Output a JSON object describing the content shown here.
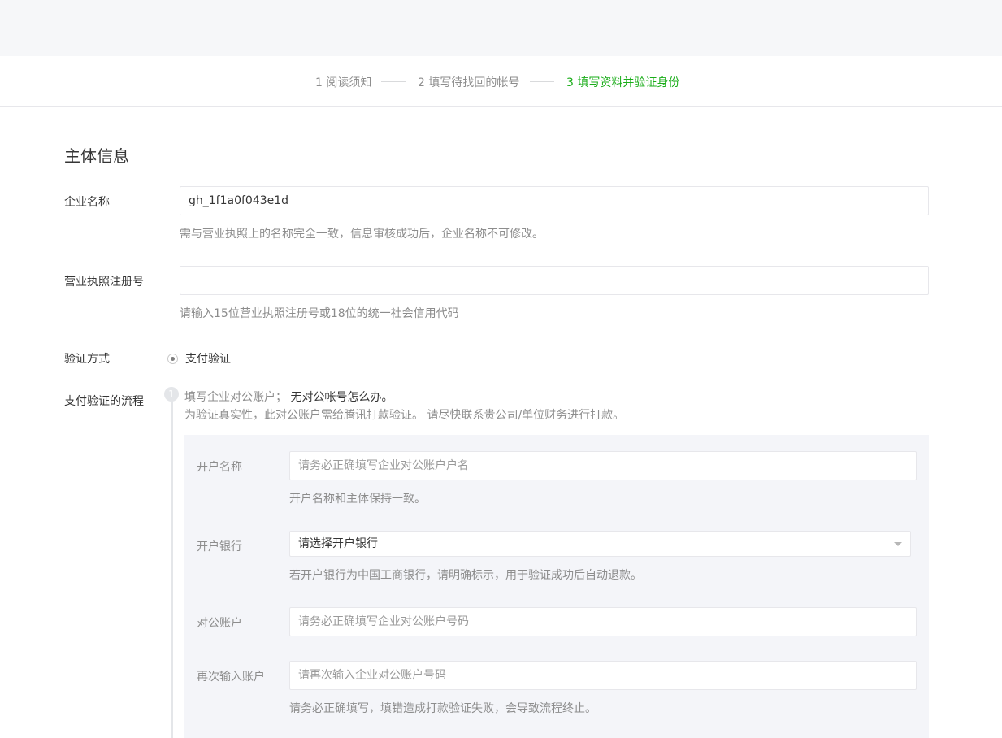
{
  "steps": [
    {
      "label": "1 阅读须知",
      "state": "done"
    },
    {
      "label": "2 填写待找回的帐号",
      "state": "done"
    },
    {
      "label": "3 填写资料并验证身份",
      "state": "active"
    }
  ],
  "colors": {
    "accent": "#1aad19",
    "muted": "#8d8d8d",
    "panel": "#f4f5f9"
  },
  "section": {
    "title": "主体信息"
  },
  "company_name": {
    "label": "企业名称",
    "value": "gh_1f1a0f043e1d",
    "hint": "需与营业执照上的名称完全一致，信息审核成功后，企业名称不可修改。"
  },
  "license": {
    "label": "营业执照注册号",
    "value": "",
    "hint": "请输入15位营业执照注册号或18位的统一社会信用代码"
  },
  "verify_method": {
    "label": "验证方式",
    "option": "支付验证",
    "selected": true
  },
  "flow": {
    "label": "支付验证的流程",
    "step_number": "1",
    "line1_text": "填写企业对公账户；",
    "line1_link": "无对公帐号怎么办。",
    "line2_text": "为验证真实性，此对公账户需给腾讯打款验证。 请尽快联系贵公司/单位财务进行打款。"
  },
  "account_name": {
    "label": "开户名称",
    "placeholder": "请务必正确填写企业对公账户户名",
    "hint": "开户名称和主体保持一致。"
  },
  "bank": {
    "label": "开户银行",
    "selected": "请选择开户银行",
    "hint": "若开户银行为中国工商银行，请明确标示，用于验证成功后自动退款。"
  },
  "account_number": {
    "label": "对公账户",
    "placeholder": "请务必正确填写企业对公账户号码"
  },
  "account_confirm": {
    "label": "再次输入账户",
    "placeholder": "请再次输入企业对公账户号码",
    "hint": "请务必正确填写，填错造成打款验证失败，会导致流程终止。"
  }
}
